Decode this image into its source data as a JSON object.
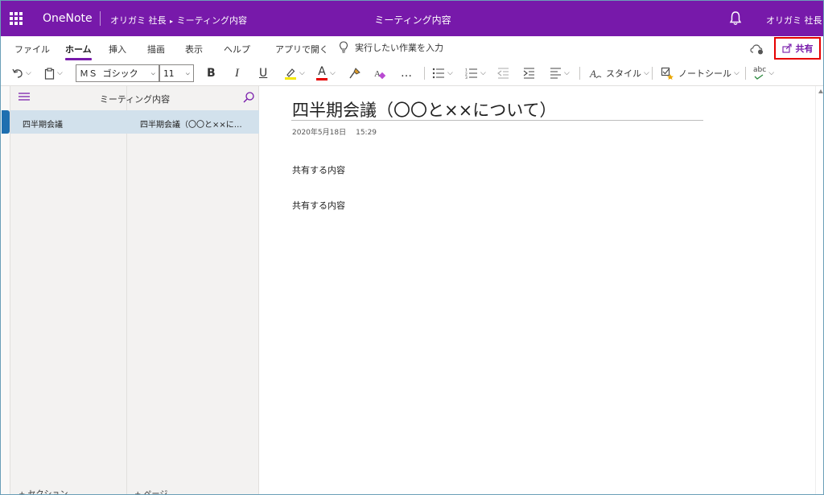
{
  "titlebar": {
    "app_name": "OneNote",
    "breadcrumb_owner": "オリガミ 社長",
    "breadcrumb_notebook": "ミーティング内容",
    "center_title": "ミーティング内容",
    "user_name": "オリガミ 社長",
    "accent_color": "#7719aa"
  },
  "tabs": [
    {
      "label": "ファイル"
    },
    {
      "label": "ホーム"
    },
    {
      "label": "挿入"
    },
    {
      "label": "描画"
    },
    {
      "label": "表示"
    },
    {
      "label": "ヘルプ"
    },
    {
      "label": "アプリで開く"
    }
  ],
  "active_tab": "ホーム",
  "tell_me": {
    "placeholder": "実行したい作業を入力",
    "icon": "lightbulb-icon"
  },
  "share_button": {
    "label": "共有",
    "icon": "share-icon",
    "highlight_color": "#e60000"
  },
  "toolbar": {
    "font_name": "ＭＳ ゴシック",
    "font_size": "11",
    "bold": "B",
    "italic": "I",
    "underline": "U",
    "font_color_letter": "A",
    "more": "…",
    "styles_label": "スタイル",
    "tags_label": "ノートシール",
    "spell_label": "abc"
  },
  "sections_pane": {
    "header": "ミーティング内容",
    "sections": [
      {
        "label": "四半期会議",
        "color": "#1e6fb0"
      }
    ],
    "add_label": "+ セクション"
  },
  "pages_pane": {
    "pages": [
      {
        "label": "四半期会議（〇〇と××に…"
      }
    ],
    "add_label": "+ ページ"
  },
  "page": {
    "title": "四半期会議（〇〇と××について）",
    "date": "2020年5月18日",
    "time": "15:29",
    "paragraphs": [
      "共有する内容",
      "共有する内容"
    ]
  }
}
